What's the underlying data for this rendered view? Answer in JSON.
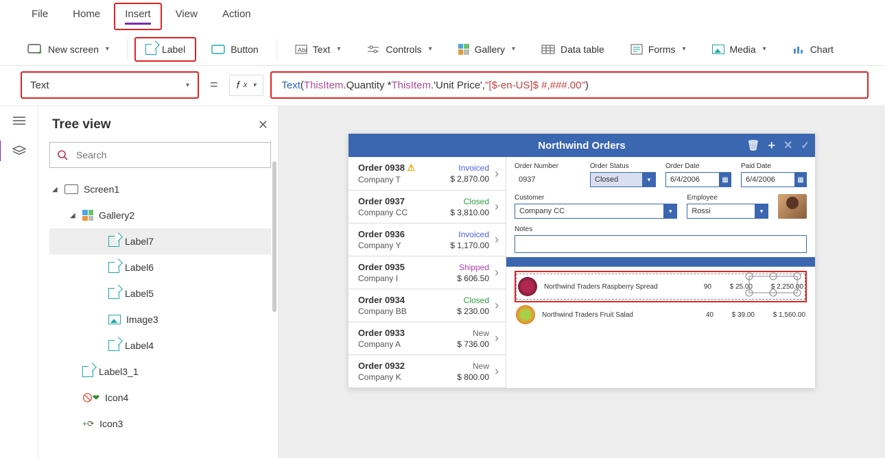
{
  "menu": {
    "file": "File",
    "home": "Home",
    "insert": "Insert",
    "view": "View",
    "action": "Action"
  },
  "ribbon": {
    "newscreen": "New screen",
    "label": "Label",
    "button": "Button",
    "text": "Text",
    "controls": "Controls",
    "gallery": "Gallery",
    "datatable": "Data table",
    "forms": "Forms",
    "media": "Media",
    "chart": "Chart"
  },
  "property": {
    "selected": "Text"
  },
  "formula": {
    "fn": "Text",
    "lp": "( ",
    "kw1": "ThisItem",
    "dot1": ".Quantity * ",
    "kw2": "ThisItem",
    "dot2": ".'Unit Price', ",
    "str": "\"[$-en-US]$ #,###.00\"",
    "rp": " )"
  },
  "treepane": {
    "title": "Tree view",
    "search_placeholder": "Search",
    "nodes": {
      "screen1": "Screen1",
      "gallery2": "Gallery2",
      "label7": "Label7",
      "label6": "Label6",
      "label5": "Label5",
      "image3": "Image3",
      "label4": "Label4",
      "label3_1": "Label3_1",
      "icon4": "Icon4",
      "icon3": "Icon3"
    }
  },
  "appview": {
    "title": "Northwind Orders",
    "orders": [
      {
        "id": "Order 0938",
        "company": "Company T",
        "status": "Invoiced",
        "statusClass": "s-inv",
        "amount": "$ 2,870.00",
        "warn": true
      },
      {
        "id": "Order 0937",
        "company": "Company CC",
        "status": "Closed",
        "statusClass": "s-closed",
        "amount": "$ 3,810.00"
      },
      {
        "id": "Order 0936",
        "company": "Company Y",
        "status": "Invoiced",
        "statusClass": "s-inv",
        "amount": "$ 1,170.00"
      },
      {
        "id": "Order 0935",
        "company": "Company I",
        "status": "Shipped",
        "statusClass": "s-ship",
        "amount": "$ 606.50"
      },
      {
        "id": "Order 0934",
        "company": "Company BB",
        "status": "Closed",
        "statusClass": "s-closed",
        "amount": "$ 230.00"
      },
      {
        "id": "Order 0933",
        "company": "Company A",
        "status": "New",
        "statusClass": "s-new",
        "amount": "$ 736.00"
      },
      {
        "id": "Order 0932",
        "company": "Company K",
        "status": "New",
        "statusClass": "s-new",
        "amount": "$ 800.00"
      }
    ],
    "detail": {
      "labels": {
        "ordernum": "Order Number",
        "status": "Order Status",
        "orderdate": "Order Date",
        "paiddate": "Paid Date",
        "customer": "Customer",
        "employee": "Employee",
        "notes": "Notes"
      },
      "values": {
        "ordernum": "0937",
        "status": "Closed",
        "orderdate": "6/4/2006",
        "paiddate": "6/4/2006",
        "customer": "Company CC",
        "employee": "Rossi"
      }
    },
    "lines": [
      {
        "name": "Northwind Traders Raspberry Spread",
        "qty": "90",
        "price": "$ 25.00",
        "total": "$ 2,250.00"
      },
      {
        "name": "Northwind Traders Fruit Salad",
        "qty": "40",
        "price": "$ 39.00",
        "total": "$ 1,560.00"
      }
    ]
  }
}
